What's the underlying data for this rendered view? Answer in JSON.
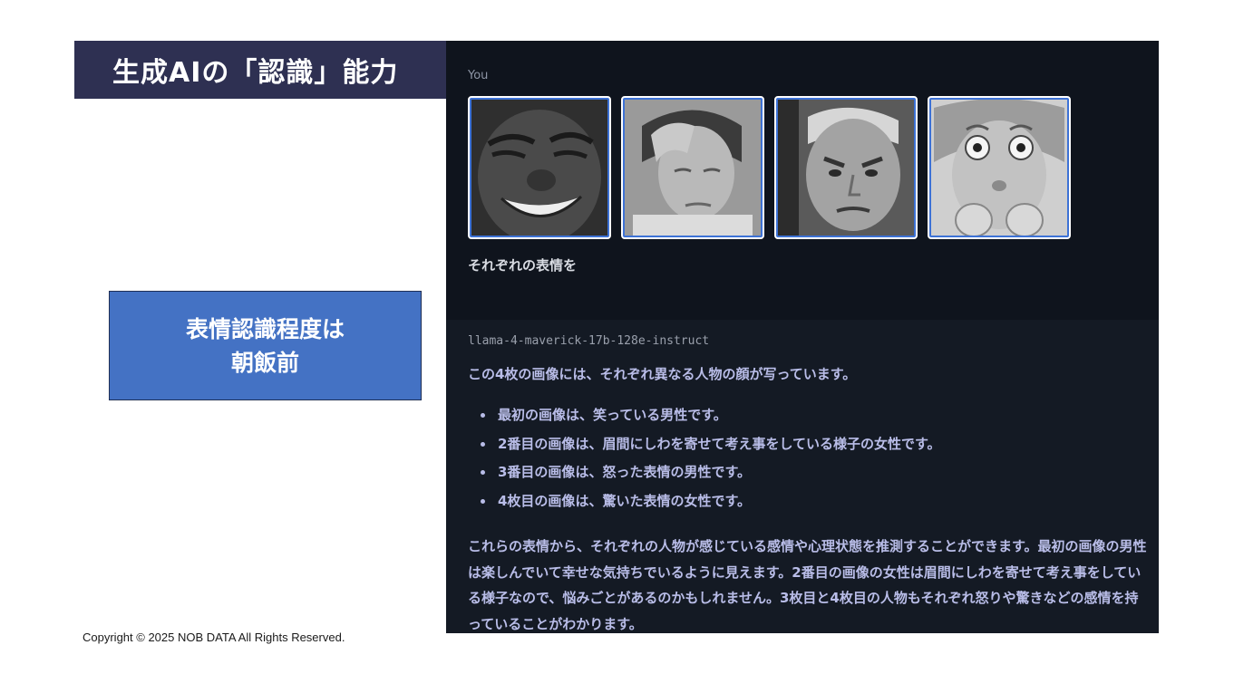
{
  "slide": {
    "title": "生成AIの「認識」能力",
    "callout_lines": [
      "表情認識程度は",
      "朝飯前"
    ],
    "copyright": "Copyright © 2025 NOB DATA All Rights Reserved."
  },
  "chat": {
    "user": {
      "sender": "You",
      "images": [
        {
          "icon": "laughing-man-photo"
        },
        {
          "icon": "pensive-woman-photo"
        },
        {
          "icon": "angry-man-photo"
        },
        {
          "icon": "surprised-woman-photo"
        }
      ],
      "prompt": "それぞれの表情を"
    },
    "assistant": {
      "model": "llama-4-maverick-17b-128e-instruct",
      "intro": "この4枚の画像には、それぞれ異なる人物の顔が写っています。",
      "bullets": [
        "最初の画像は、笑っている男性です。",
        "2番目の画像は、眉間にしわを寄せて考え事をしている様子の女性です。",
        "3番目の画像は、怒った表情の男性です。",
        "4枚目の画像は、驚いた表情の女性です。"
      ],
      "summary": "これらの表情から、それぞれの人物が感じている感情や心理状態を推測することができます。最初の画像の男性は楽しんでいて幸せな気持ちでいるように見えます。2番目の画像の女性は眉間にしわを寄せて考え事をしている様子なので、悩みごとがあるのかもしれません。3枚目と4枚目の人物もそれぞれ怒りや驚きなどの感情を持っていることがわかります。"
    }
  },
  "colors": {
    "title_bg": "#2e3052",
    "callout_bg": "#4472c4",
    "chat_bg": "#111722",
    "response_text": "#b9bde8"
  }
}
